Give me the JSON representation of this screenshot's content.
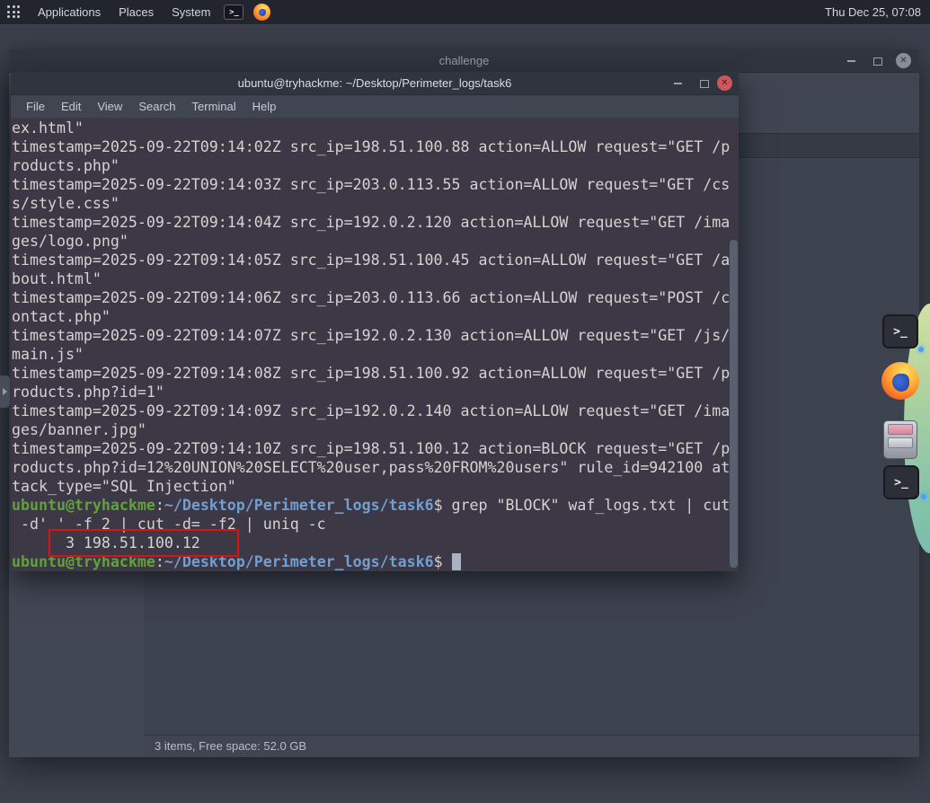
{
  "top_bar": {
    "menus": [
      "Applications",
      "Places",
      "System"
    ],
    "clock": "Thu Dec 25, 07:08"
  },
  "icons": {
    "terminal_prompt": ">_",
    "close_glyph": "✕"
  },
  "colors": {
    "prompt_green": "#61a13e",
    "path_blue": "#729fcf",
    "terminal_bg": "#3c3845",
    "close_button_red": "#cc575d",
    "highlight_red": "#dd1111",
    "panel_bg": "#22252d",
    "window_bg": "#404552"
  },
  "challenge_window": {
    "title": "challenge",
    "status_text": "3 items, Free space: 52.0 GB"
  },
  "desktop": {
    "shortcuts": [
      "terminal",
      "firefox",
      "file-cabinet",
      "terminal"
    ]
  },
  "terminal_window": {
    "title": "ubuntu@tryhackme: ~/Desktop/Perimeter_logs/task6",
    "menu_items": [
      "File",
      "Edit",
      "View",
      "Search",
      "Terminal",
      "Help"
    ],
    "prompt": {
      "user_host": "ubuntu@tryhackme",
      "path": "~/Desktop/Perimeter_logs/task6"
    },
    "command": "grep \"BLOCK\" waf_logs.txt | cut -d' ' -f 2 | cut -d= -f2 | uniq -c",
    "command_output": "3 198.51.100.12",
    "lines": [
      {
        "seg": [
          {
            "c": "fg",
            "t": "ex.html\""
          }
        ]
      },
      {
        "seg": [
          {
            "c": "fg",
            "t": "timestamp=2025-09-22T09:14:02Z src_ip=198.51.100.88 action=ALLOW request=\"GET /p"
          }
        ]
      },
      {
        "seg": [
          {
            "c": "fg",
            "t": "roducts.php\""
          }
        ]
      },
      {
        "seg": [
          {
            "c": "fg",
            "t": "timestamp=2025-09-22T09:14:03Z src_ip=203.0.113.55 action=ALLOW request=\"GET /cs"
          }
        ]
      },
      {
        "seg": [
          {
            "c": "fg",
            "t": "s/style.css\""
          }
        ]
      },
      {
        "seg": [
          {
            "c": "fg",
            "t": "timestamp=2025-09-22T09:14:04Z src_ip=192.0.2.120 action=ALLOW request=\"GET /ima"
          }
        ]
      },
      {
        "seg": [
          {
            "c": "fg",
            "t": "ges/logo.png\""
          }
        ]
      },
      {
        "seg": [
          {
            "c": "fg",
            "t": "timestamp=2025-09-22T09:14:05Z src_ip=198.51.100.45 action=ALLOW request=\"GET /a"
          }
        ]
      },
      {
        "seg": [
          {
            "c": "fg",
            "t": "bout.html\""
          }
        ]
      },
      {
        "seg": [
          {
            "c": "fg",
            "t": "timestamp=2025-09-22T09:14:06Z src_ip=203.0.113.66 action=ALLOW request=\"POST /c"
          }
        ]
      },
      {
        "seg": [
          {
            "c": "fg",
            "t": "ontact.php\""
          }
        ]
      },
      {
        "seg": [
          {
            "c": "fg",
            "t": "timestamp=2025-09-22T09:14:07Z src_ip=192.0.2.130 action=ALLOW request=\"GET /js/"
          }
        ]
      },
      {
        "seg": [
          {
            "c": "fg",
            "t": "main.js\""
          }
        ]
      },
      {
        "seg": [
          {
            "c": "fg",
            "t": "timestamp=2025-09-22T09:14:08Z src_ip=198.51.100.92 action=ALLOW request=\"GET /p"
          }
        ]
      },
      {
        "seg": [
          {
            "c": "fg",
            "t": "roducts.php?id=1\""
          }
        ]
      },
      {
        "seg": [
          {
            "c": "fg",
            "t": "timestamp=2025-09-22T09:14:09Z src_ip=192.0.2.140 action=ALLOW request=\"GET /ima"
          }
        ]
      },
      {
        "seg": [
          {
            "c": "fg",
            "t": "ges/banner.jpg\""
          }
        ]
      },
      {
        "seg": [
          {
            "c": "fg",
            "t": "timestamp=2025-09-22T09:14:10Z src_ip=198.51.100.12 action=BLOCK request=\"GET /p"
          }
        ]
      },
      {
        "seg": [
          {
            "c": "fg",
            "t": "roducts.php?id=12%20UNION%20SELECT%20user,pass%20FROM%20users\" rule_id=942100 at"
          }
        ]
      },
      {
        "seg": [
          {
            "c": "fg",
            "t": "tack_type=\"SQL Injection\""
          }
        ]
      },
      {
        "seg": [
          {
            "c": "green",
            "t": "ubuntu@tryhackme"
          },
          {
            "c": "fg",
            "t": ":"
          },
          {
            "c": "blue",
            "t": "~/Desktop/Perimeter_logs/task6"
          },
          {
            "c": "fg",
            "t": "$ grep \"BLOCK\" waf_logs.txt | cut"
          }
        ]
      },
      {
        "seg": [
          {
            "c": "fg",
            "t": " -d' ' -f 2 | cut -d= -f2 | uniq -c"
          }
        ]
      },
      {
        "seg": [
          {
            "c": "fg",
            "t": "      3 198.51.100.12"
          }
        ]
      },
      {
        "seg": [
          {
            "c": "green",
            "t": "ubuntu@tryhackme"
          },
          {
            "c": "fg",
            "t": ":"
          },
          {
            "c": "blue",
            "t": "~/Desktop/Perimeter_logs/task6"
          },
          {
            "c": "fg",
            "t": "$ "
          },
          {
            "c": "cursor",
            "t": " "
          }
        ]
      }
    ]
  },
  "annotation": {
    "highlighted_text": "3 198.51.100.12"
  }
}
